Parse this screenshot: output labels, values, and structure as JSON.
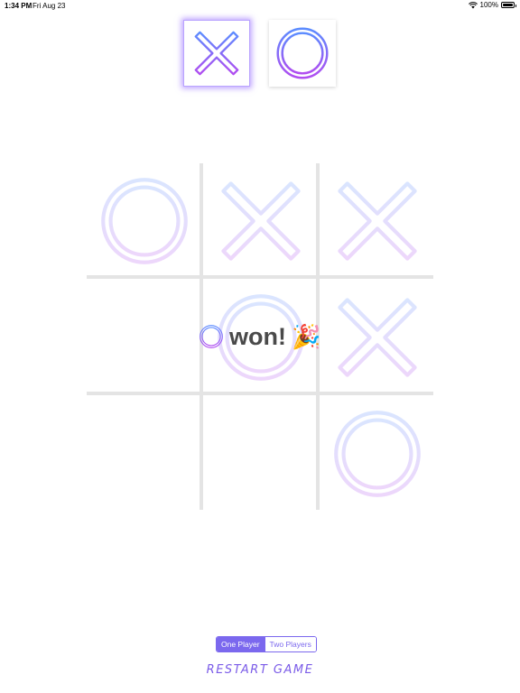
{
  "status_bar": {
    "time": "1:34 PM",
    "date": "Fri Aug 23",
    "battery": "100%"
  },
  "player_choice": {
    "selected": "X",
    "options": [
      "X",
      "O"
    ]
  },
  "board": {
    "cells": [
      "O",
      "X",
      "X",
      "",
      "O",
      "X",
      "",
      "",
      "O"
    ]
  },
  "result": {
    "winner": "O",
    "text": "won!",
    "emoji": "🎉"
  },
  "mode_control": {
    "options": [
      "One Player",
      "Two Players"
    ],
    "selected": "One Player"
  },
  "restart_label": "RESTART GAME",
  "colors": {
    "gradient_start": "#5b8cff",
    "gradient_end": "#b14cf0",
    "accent": "#7b68ee",
    "grid": "#e4e4e4"
  }
}
